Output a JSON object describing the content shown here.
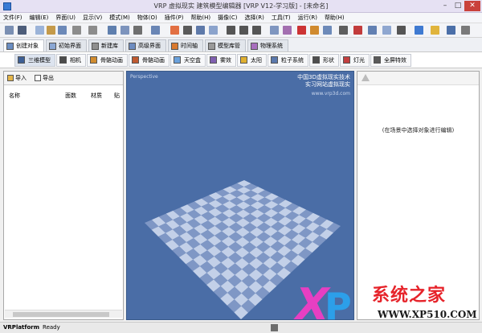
{
  "window": {
    "title": "VRP 虚拟现实 建筑模型编辑器 [VRP V12-学习版] - [未命名]"
  },
  "menu": [
    "文件(F)",
    "编辑(E)",
    "界面(U)",
    "显示(V)",
    "模式(M)",
    "物体(O)",
    "插件(P)",
    "帮助(H)",
    "摄像(C)",
    "选择(R)",
    "工具(T)",
    "运行(R)",
    "帮助(H)"
  ],
  "tabs_top": [
    "创建对象",
    "初始界面",
    "新建库",
    "高级界面",
    "时间轴",
    "模型库管",
    "物理系统"
  ],
  "tabs_second": [
    "三维模型",
    "相机",
    "骨骼动画",
    "骨骼动画",
    "天空盒",
    "雾效",
    "太阳",
    "粒子系统",
    "形状",
    "灯光",
    "全屏特效"
  ],
  "left_panel": {
    "import_label": "导入",
    "export_label": "导出",
    "columns": [
      "名称",
      "面数",
      "材质",
      "贴"
    ]
  },
  "viewport": {
    "corner_label": "Perspective",
    "info_lines": [
      "中国3D虚拟现实技术",
      "实习网站虚拟现实",
      "WWW.VRP3D.COM"
    ],
    "url": "www.vrp3d.com"
  },
  "right_panel": {
    "message": "(在场景中选择对象进行编辑)"
  },
  "statusbar": {
    "brand": "VRPlatform",
    "state": "Ready"
  },
  "watermark": {
    "logo_x": "X",
    "logo_p": "P",
    "brand": "系统之家",
    "url": "WWW.XP510.COM"
  },
  "colors": {
    "viewport_bg": "#4a6da6",
    "checker_light": "#c3d0e8",
    "checker_dark": "#7f97c5"
  }
}
